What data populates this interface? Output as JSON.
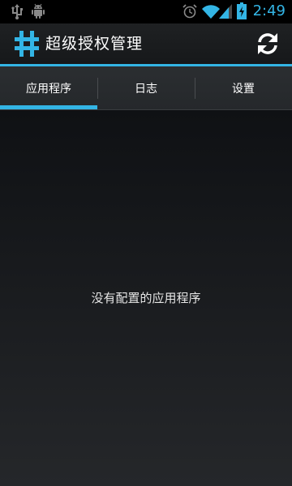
{
  "status_bar": {
    "time": "2:49",
    "icons": [
      "usb-icon",
      "android-icon",
      "alarm-icon",
      "wifi-icon",
      "signal-icon",
      "battery-charging-icon"
    ],
    "clock_color": "#33b5e5"
  },
  "action_bar": {
    "title": "超级授权管理",
    "app_icon": "hash-icon",
    "refresh_icon": "refresh-icon",
    "accent_color": "#33b5e5"
  },
  "tabs": [
    {
      "label": "应用程序",
      "selected": true
    },
    {
      "label": "日志",
      "selected": false
    },
    {
      "label": "设置",
      "selected": false
    }
  ],
  "content": {
    "empty_message": "没有配置的应用程序"
  }
}
